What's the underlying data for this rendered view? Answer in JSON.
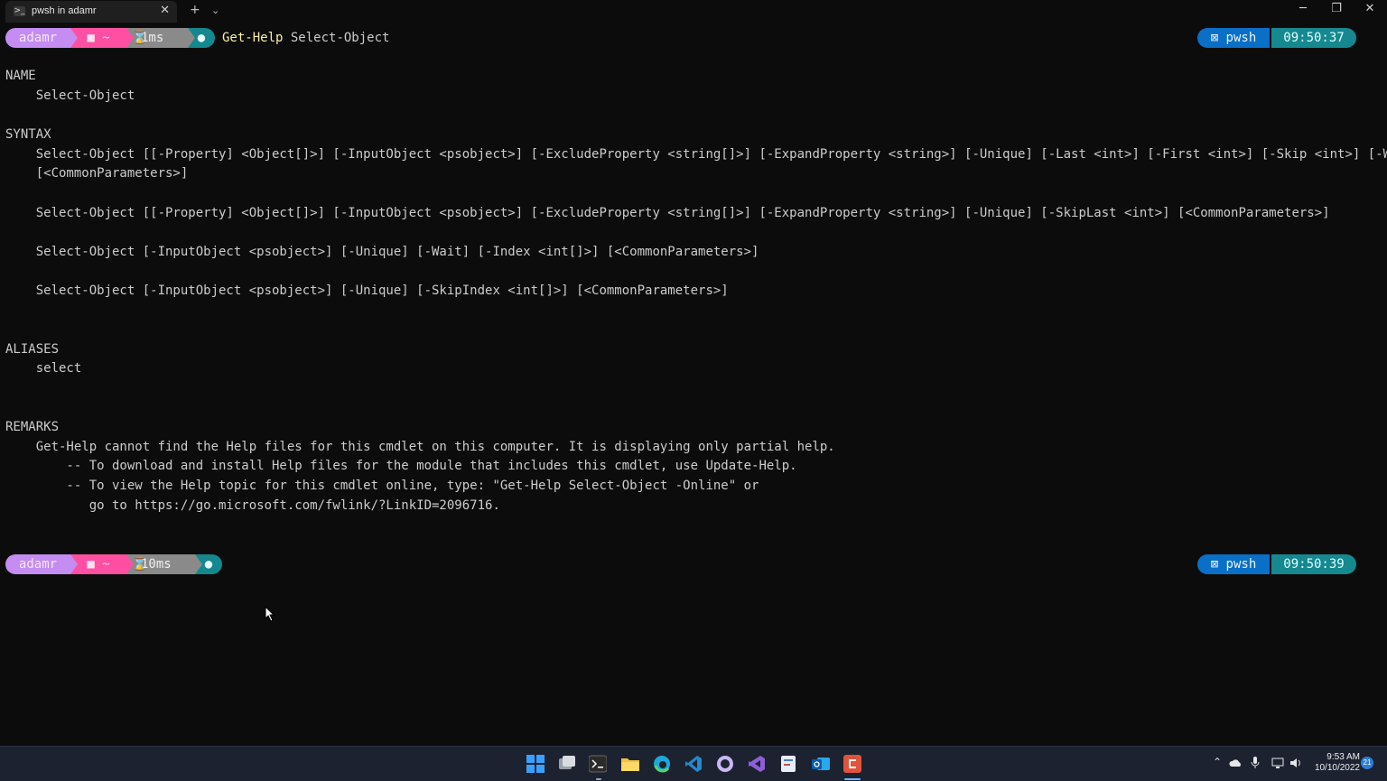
{
  "window": {
    "tab_title": "pwsh in adamr",
    "new_tab_label": "+",
    "dropdown_label": "⌄",
    "minimize_label": "─",
    "restore_label": "❐",
    "close_label": "✕",
    "tab_close_label": "✕"
  },
  "prompt1": {
    "user": "adamr",
    "dir": "■ ~",
    "duration": "1ms",
    "git": "●",
    "command_keyword": "Get-Help",
    "command_arg": "Select-Object",
    "shell": "⊠ pwsh",
    "time": "09:50:37"
  },
  "output": {
    "name_header": "NAME",
    "name_value": "    Select-Object",
    "syntax_header": "SYNTAX",
    "syntax_lines": [
      "    Select-Object [[-Property] <Object[]>] [-InputObject <psobject>] [-ExcludeProperty <string[]>] [-ExpandProperty <string>] [-Unique] [-Last <int>] [-First <int>] [-Skip <int>] [-Wait]",
      "    [<CommonParameters>]",
      "",
      "    Select-Object [[-Property] <Object[]>] [-InputObject <psobject>] [-ExcludeProperty <string[]>] [-ExpandProperty <string>] [-Unique] [-SkipLast <int>] [<CommonParameters>]",
      "",
      "    Select-Object [-InputObject <psobject>] [-Unique] [-Wait] [-Index <int[]>] [<CommonParameters>]",
      "",
      "    Select-Object [-InputObject <psobject>] [-Unique] [-SkipIndex <int[]>] [<CommonParameters>]"
    ],
    "aliases_header": "ALIASES",
    "aliases_value": "    select",
    "remarks_header": "REMARKS",
    "remarks_lines": [
      "    Get-Help cannot find the Help files for this cmdlet on this computer. It is displaying only partial help.",
      "        -- To download and install Help files for the module that includes this cmdlet, use Update-Help.",
      "        -- To view the Help topic for this cmdlet online, type: \"Get-Help Select-Object -Online\" or",
      "           go to https://go.microsoft.com/fwlink/?LinkID=2096716."
    ]
  },
  "prompt2": {
    "user": "adamr",
    "dir": "■ ~",
    "duration": "10ms",
    "git": "●",
    "shell": "⊠ pwsh",
    "time": "09:50:39"
  },
  "taskbar": {
    "time": "9:53 AM",
    "date": "10/10/2022",
    "notification_count": "21",
    "apps": [
      "start-icon",
      "task-view-icon",
      "terminal-icon",
      "file-explorer-icon",
      "edge-icon",
      "vscode-icon",
      "github-icon",
      "visual-studio-icon",
      "paint-icon",
      "outlook-icon",
      "camtasia-icon"
    ],
    "tray_icons": [
      "chevron-up-icon",
      "onedrive-icon",
      "microphone-icon",
      "network-icon",
      "volume-icon"
    ]
  },
  "colors": {
    "background": "#0c0c0c",
    "user_segment": "#c58cf2",
    "dir_segment": "#ff4fa3",
    "time_segment": "#8a8a8a",
    "git_segment": "#14878f",
    "shell_segment": "#0a6fc7",
    "clock_segment": "#16888f",
    "command_keyword": "#f9f1a5"
  }
}
